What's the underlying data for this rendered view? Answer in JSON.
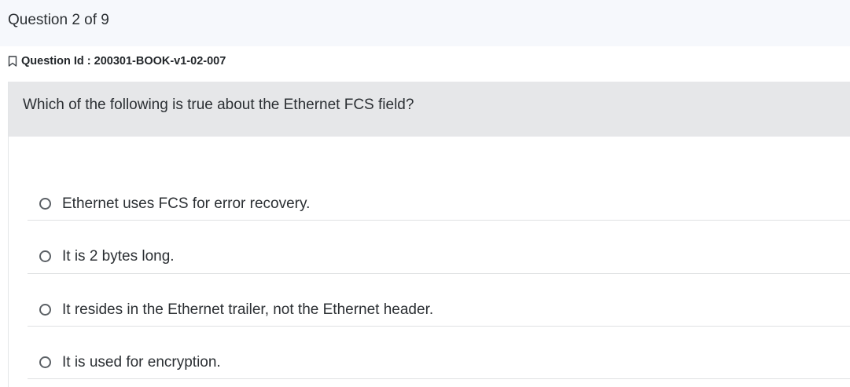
{
  "header": {
    "progress": "Question 2 of 9"
  },
  "question": {
    "id_label": "Question Id : 200301-BOOK-v1-02-007",
    "text": "Which of the following is true about the Ethernet FCS field?"
  },
  "options": [
    {
      "label": "Ethernet uses FCS for error recovery."
    },
    {
      "label": "It is 2 bytes long."
    },
    {
      "label": "It resides in the Ethernet trailer, not the Ethernet header."
    },
    {
      "label": "It is used for encryption."
    }
  ],
  "icons": {
    "bookmark": "bookmark-icon",
    "radio": "radio-unchecked-icon"
  }
}
